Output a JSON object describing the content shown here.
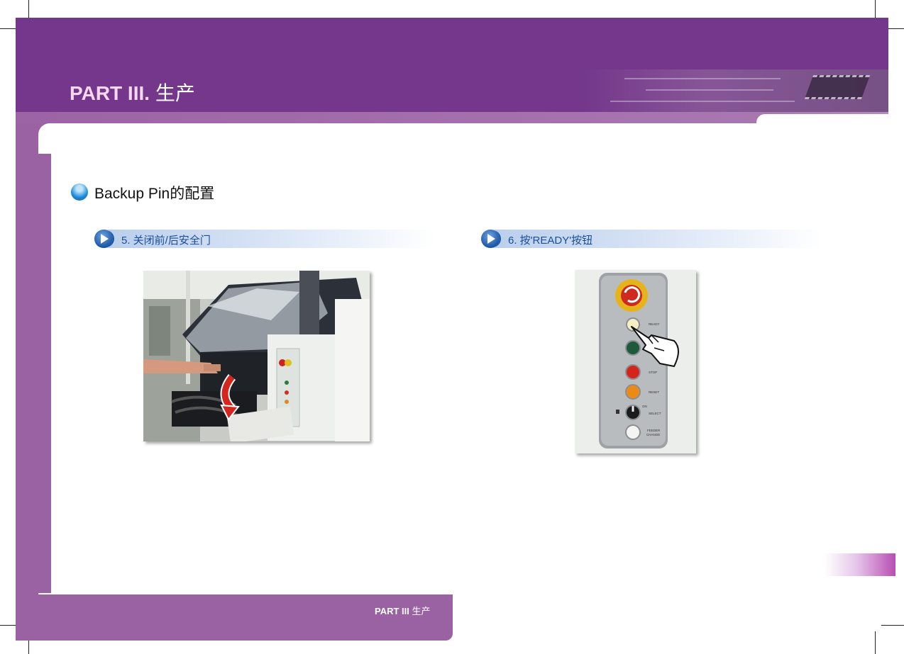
{
  "header": {
    "part_label": "PART III.",
    "part_title": "生产"
  },
  "section": {
    "title": "Backup Pin的配置"
  },
  "steps": [
    {
      "label": "5. 关闭前/后安全门"
    },
    {
      "label": "6. 按'READY'按钮"
    }
  ],
  "panel": {
    "ready": "READY",
    "stop": "STOP",
    "reset": "RESET",
    "on": "ON",
    "select": "SELECT",
    "feeder": "FEEDER",
    "change": "CHANGE"
  },
  "footer": {
    "part": "PART III",
    "title": "生产"
  },
  "colors": {
    "purple": "#74378b",
    "light_purple": "#9a62a3",
    "blue_text": "#1a4e9a"
  }
}
